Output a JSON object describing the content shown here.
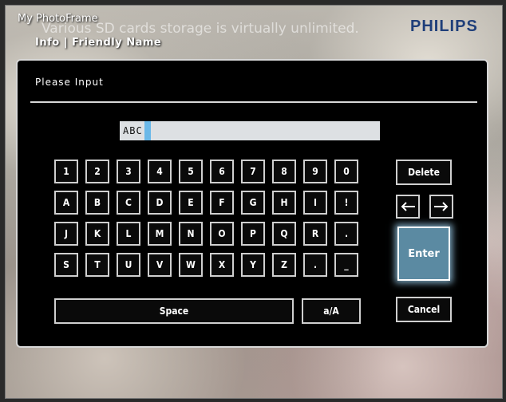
{
  "app": {
    "title": "My PhotoFrame",
    "breadcrumb": "Info | Friendly Name",
    "watermark": "Various SD cards storage is virtually unlimited.",
    "logo": "PHILIPS"
  },
  "dialog": {
    "title": "Please Input",
    "input_value": "ABC",
    "keys_row1": [
      "1",
      "2",
      "3",
      "4",
      "5",
      "6",
      "7",
      "8",
      "9",
      "0"
    ],
    "keys_row2": [
      "A",
      "B",
      "C",
      "D",
      "E",
      "F",
      "G",
      "H",
      "I",
      "!"
    ],
    "keys_row3": [
      "J",
      "K",
      "L",
      "M",
      "N",
      "O",
      "P",
      "Q",
      "R",
      "."
    ],
    "keys_row4": [
      "S",
      "T",
      "U",
      "V",
      "W",
      "X",
      "Y",
      "Z",
      ".",
      "_"
    ],
    "space_label": "Space",
    "case_label": "a/A",
    "delete_label": "Delete",
    "enter_label": "Enter",
    "cancel_label": "Cancel"
  },
  "colors": {
    "dialog_bg": "#000000",
    "key_border": "#cfcfcf",
    "enter_bg": "#5b8aa2",
    "caret": "#6ab8e8",
    "logo": "#1f3f7a"
  },
  "icons": {
    "left": "arrow-left-icon",
    "right": "arrow-right-icon"
  }
}
